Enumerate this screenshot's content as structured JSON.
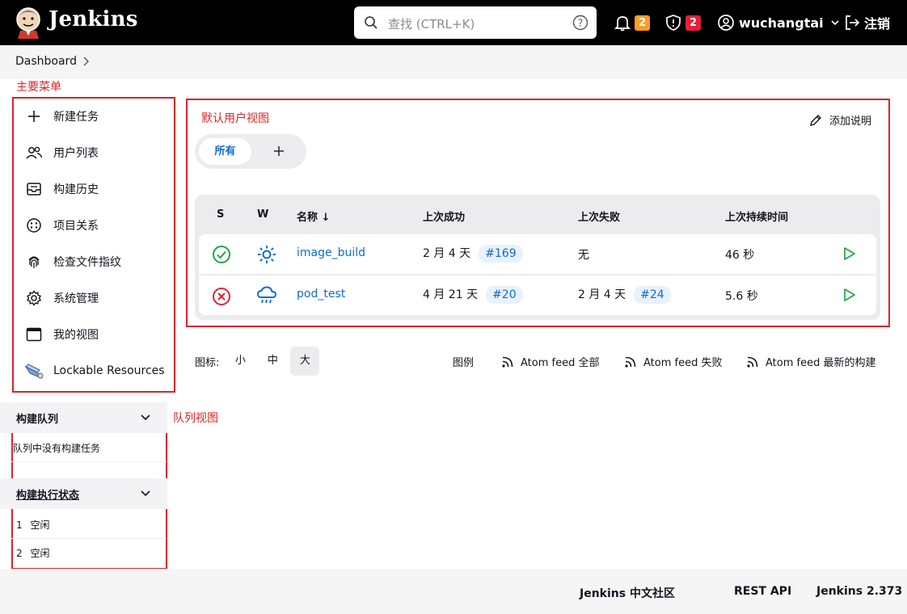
{
  "header": {
    "brand": "Jenkins",
    "search_placeholder": "查找 (CTRL+K)",
    "notifications_count": "2",
    "security_count": "2",
    "username": "wuchangtai",
    "logout_label": "注销",
    "colors": {
      "bg": "#000000",
      "notif_badge": "#fe9d2a",
      "security_badge": "#e6203a"
    }
  },
  "breadcrumb": {
    "items": [
      "Dashboard"
    ]
  },
  "annotations": {
    "main_menu": "主要菜单",
    "default_view": "默认用户视图",
    "queue_view": "队列视图",
    "color": "#e52222"
  },
  "sidebar": {
    "items": [
      {
        "label": "新建任务",
        "icon": "plus-icon"
      },
      {
        "label": "用户列表",
        "icon": "people-icon"
      },
      {
        "label": "构建历史",
        "icon": "inbox-icon"
      },
      {
        "label": "项目关系",
        "icon": "relationship-icon"
      },
      {
        "label": "检查文件指纹",
        "icon": "fingerprint-icon"
      },
      {
        "label": "系统管理",
        "icon": "gear-icon"
      },
      {
        "label": "我的视图",
        "icon": "window-icon"
      },
      {
        "label": "Lockable Resources",
        "icon": "lock-resource-icon"
      }
    ]
  },
  "main": {
    "add_description": "添加说明",
    "tabs": [
      {
        "label": "所有",
        "active": true
      }
    ],
    "table": {
      "headers": {
        "s": "S",
        "w": "W",
        "name": "名称 ↓",
        "last_success": "上次成功",
        "last_failure": "上次失败",
        "last_duration": "上次持续时间"
      },
      "rows": [
        {
          "status": "success",
          "weather": "sunny",
          "name": "image_build",
          "last_success": "2 月 4 天",
          "last_success_build": "#169",
          "last_failure": "无",
          "last_failure_build": "",
          "duration": "46 秒"
        },
        {
          "status": "failure",
          "weather": "rainy",
          "name": "pod_test",
          "last_success": "4 月 21 天",
          "last_success_build": "#20",
          "last_failure": "2 月 4 天",
          "last_failure_build": "#24",
          "duration": "5.6 秒"
        }
      ]
    },
    "icon_size": {
      "label": "图标:",
      "options": [
        "小",
        "中",
        "大"
      ],
      "selected": "大"
    },
    "legend_label": "图例",
    "feeds": [
      "Atom feed 全部",
      "Atom feed 失败",
      "Atom feed 最新的构建"
    ]
  },
  "queue": {
    "title": "构建队列",
    "empty_text": "队列中没有构建任务"
  },
  "executors": {
    "title": "构建执行状态",
    "items": [
      {
        "num": "1",
        "status": "空闲"
      },
      {
        "num": "2",
        "status": "空闲"
      }
    ]
  },
  "footer": {
    "community": "Jenkins 中文社区",
    "rest_api": "REST API",
    "version": "Jenkins 2.373"
  }
}
